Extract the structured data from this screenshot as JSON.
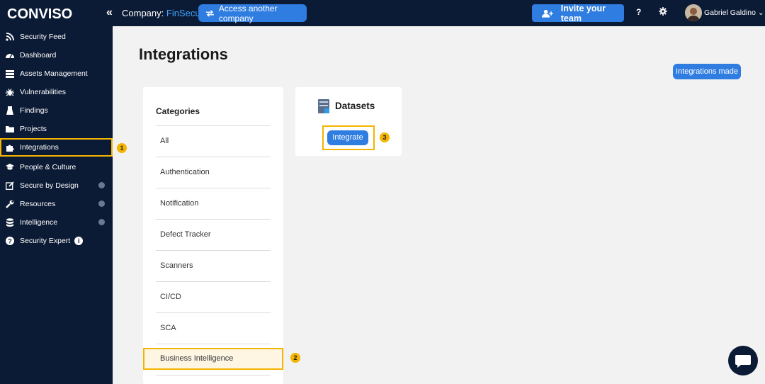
{
  "brand": "CONVISO",
  "header": {
    "collapse_icon": "«",
    "company_label": "Company:",
    "company_name": "FinSecure",
    "access_button": "Access another company",
    "invite_button": "Invite your team",
    "help_icon": "?",
    "user_name": "Gabriel Galdino"
  },
  "sidebar": {
    "items": [
      {
        "label": "Security Feed",
        "icon": "rss-icon"
      },
      {
        "label": "Dashboard",
        "icon": "dashboard-icon"
      },
      {
        "label": "Assets Management",
        "icon": "assets-icon"
      },
      {
        "label": "Vulnerabilities",
        "icon": "bug-icon"
      },
      {
        "label": "Findings",
        "icon": "findings-icon"
      },
      {
        "label": "Projects",
        "icon": "folder-icon"
      },
      {
        "label": "Integrations",
        "icon": "puzzle-icon"
      },
      {
        "label": "People & Culture",
        "icon": "graduation-cap-icon"
      },
      {
        "label": "Secure by Design",
        "icon": "edit-icon"
      },
      {
        "label": "Resources",
        "icon": "wrench-icon"
      },
      {
        "label": "Intelligence",
        "icon": "database-icon"
      },
      {
        "label": "Security Expert",
        "icon": "question-circle-icon"
      }
    ]
  },
  "main": {
    "title": "Integrations",
    "integrations_made": "Integrations made",
    "categories_title": "Categories",
    "categories": [
      "All",
      "Authentication",
      "Notification",
      "Defect Tracker",
      "Scanners",
      "CI/CD",
      "SCA",
      "Business Intelligence"
    ],
    "dataset": {
      "title": "Datasets",
      "button": "Integrate"
    }
  },
  "badges": [
    "1",
    "2",
    "3"
  ],
  "colors": {
    "navy": "#0c1b35",
    "accent_blue": "#2f7de1",
    "highlight": "#f4b400",
    "company_blue": "#3fa4ff"
  }
}
